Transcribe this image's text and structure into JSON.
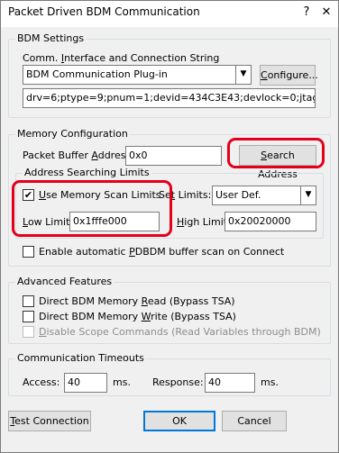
{
  "window": {
    "title": "Packet Driven BDM Communication",
    "help_glyph": "?",
    "close_glyph": "✕"
  },
  "bdm_settings": {
    "group_label": "BDM Settings",
    "conn_label": "Comm. Interface and Connection String",
    "plugin_value": "BDM Communication Plug-in",
    "configure_label": "Configure...",
    "connection_string": "drv=6;ptype=9;pnum=1;devid=434C3E43;devlock=0;jtagspd=500"
  },
  "memory_config": {
    "group_label": "Memory Configuration",
    "packet_buffer_label": "Packet Buffer Address:",
    "packet_buffer_value": "0x0",
    "search_address_label": "Search Address",
    "limits_group_label": "Address Searching Limits",
    "use_scan_limits_label": "Use Memory Scan Limits",
    "use_scan_limits_checked": true,
    "set_limits_label": "Set Limits:",
    "set_limits_value": "User Def.",
    "low_limit_label": "Low Limit:",
    "low_limit_value": "0x1fffe000",
    "high_limit_label": "High Limit:",
    "high_limit_value": "0x20020000",
    "auto_scan_label": "Enable automatic PDBDM buffer scan on Connect",
    "auto_scan_checked": false
  },
  "advanced": {
    "group_label": "Advanced Features",
    "direct_read_label": "Direct BDM Memory Read (Bypass TSA)",
    "direct_write_label": "Direct BDM Memory Write (Bypass TSA)",
    "disable_scope_label": "Disable Scope Commands (Read Variables through BDM)"
  },
  "timeouts": {
    "group_label": "Communication Timeouts",
    "access_label": "Access:",
    "access_value": "40",
    "access_unit": "ms.",
    "response_label": "Response:",
    "response_value": "40",
    "response_unit": "ms."
  },
  "buttons": {
    "test_connection": "Test Connection",
    "ok": "OK",
    "cancel": "Cancel"
  },
  "icons": {
    "dropdown_arrow": "▼",
    "check_mark": "✔"
  },
  "colors": {
    "highlight_red": "#e3001b",
    "focus_blue": "#0078d7"
  }
}
